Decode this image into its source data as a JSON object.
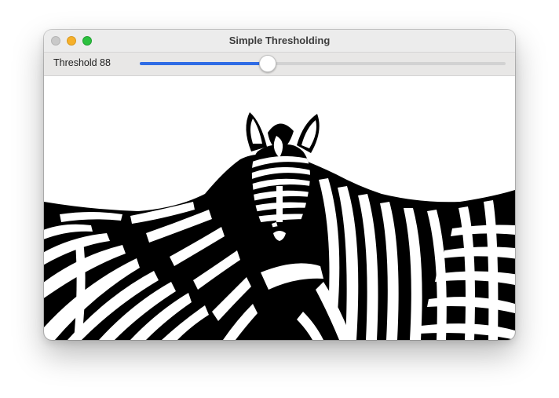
{
  "window": {
    "title": "Simple Thresholding"
  },
  "controls": {
    "threshold_label": "Threshold 88",
    "threshold_fraction": 0.35
  },
  "image": {
    "description_icon": "thresholded-zebra-image"
  },
  "colors": {
    "accent": "#2f6ce5",
    "foreground": "#000000",
    "background": "#ffffff"
  }
}
